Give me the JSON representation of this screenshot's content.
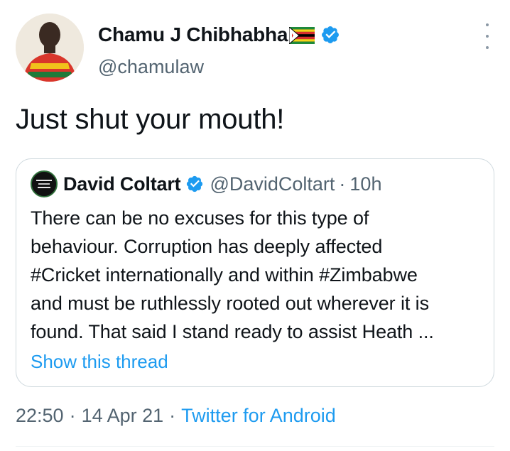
{
  "tweet": {
    "author_name": "Chamu J Chibhabha",
    "author_handle": "@chamulaw",
    "text": "Just shut your mouth!",
    "time": "22:50",
    "date": "14 Apr 21",
    "separator": "·",
    "source": "Twitter for Android",
    "icons": {
      "avatar": "avatar",
      "flag": "zimbabwe-flag-icon",
      "verified": "verified-badge-icon",
      "more": "more-options-icon"
    }
  },
  "quoted_tweet": {
    "author_name": "David Coltart",
    "author_handle": "@DavidColtart",
    "separator": "·",
    "time_ago": "10h",
    "lines": [
      "There can be no excuses for this type of",
      "behaviour. Corruption has deeply affected",
      "#Cricket internationally and within #Zimbabwe",
      "and must be ruthlessly rooted out wherever it is",
      "found. That said I stand ready to assist Heath ..."
    ],
    "show_thread_label": "Show this thread"
  },
  "colors": {
    "link_blue": "#1d9bf0",
    "secondary_text": "#536471",
    "border": "#cfd9de",
    "verified_blue": "#1d9bf0"
  }
}
